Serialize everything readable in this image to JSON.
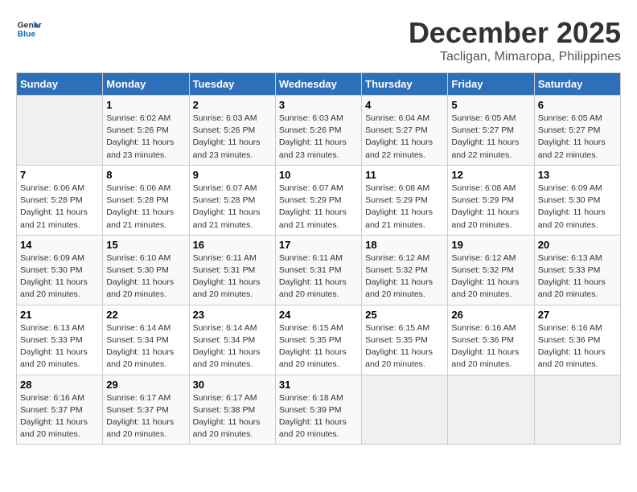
{
  "header": {
    "logo_line1": "General",
    "logo_line2": "Blue",
    "month_year": "December 2025",
    "location": "Tacligan, Mimaropa, Philippines"
  },
  "weekdays": [
    "Sunday",
    "Monday",
    "Tuesday",
    "Wednesday",
    "Thursday",
    "Friday",
    "Saturday"
  ],
  "weeks": [
    [
      {
        "day": "",
        "info": ""
      },
      {
        "day": "1",
        "info": "Sunrise: 6:02 AM\nSunset: 5:26 PM\nDaylight: 11 hours\nand 23 minutes."
      },
      {
        "day": "2",
        "info": "Sunrise: 6:03 AM\nSunset: 5:26 PM\nDaylight: 11 hours\nand 23 minutes."
      },
      {
        "day": "3",
        "info": "Sunrise: 6:03 AM\nSunset: 5:26 PM\nDaylight: 11 hours\nand 23 minutes."
      },
      {
        "day": "4",
        "info": "Sunrise: 6:04 AM\nSunset: 5:27 PM\nDaylight: 11 hours\nand 22 minutes."
      },
      {
        "day": "5",
        "info": "Sunrise: 6:05 AM\nSunset: 5:27 PM\nDaylight: 11 hours\nand 22 minutes."
      },
      {
        "day": "6",
        "info": "Sunrise: 6:05 AM\nSunset: 5:27 PM\nDaylight: 11 hours\nand 22 minutes."
      }
    ],
    [
      {
        "day": "7",
        "info": "Sunrise: 6:06 AM\nSunset: 5:28 PM\nDaylight: 11 hours\nand 21 minutes."
      },
      {
        "day": "8",
        "info": "Sunrise: 6:06 AM\nSunset: 5:28 PM\nDaylight: 11 hours\nand 21 minutes."
      },
      {
        "day": "9",
        "info": "Sunrise: 6:07 AM\nSunset: 5:28 PM\nDaylight: 11 hours\nand 21 minutes."
      },
      {
        "day": "10",
        "info": "Sunrise: 6:07 AM\nSunset: 5:29 PM\nDaylight: 11 hours\nand 21 minutes."
      },
      {
        "day": "11",
        "info": "Sunrise: 6:08 AM\nSunset: 5:29 PM\nDaylight: 11 hours\nand 21 minutes."
      },
      {
        "day": "12",
        "info": "Sunrise: 6:08 AM\nSunset: 5:29 PM\nDaylight: 11 hours\nand 20 minutes."
      },
      {
        "day": "13",
        "info": "Sunrise: 6:09 AM\nSunset: 5:30 PM\nDaylight: 11 hours\nand 20 minutes."
      }
    ],
    [
      {
        "day": "14",
        "info": "Sunrise: 6:09 AM\nSunset: 5:30 PM\nDaylight: 11 hours\nand 20 minutes."
      },
      {
        "day": "15",
        "info": "Sunrise: 6:10 AM\nSunset: 5:30 PM\nDaylight: 11 hours\nand 20 minutes."
      },
      {
        "day": "16",
        "info": "Sunrise: 6:11 AM\nSunset: 5:31 PM\nDaylight: 11 hours\nand 20 minutes."
      },
      {
        "day": "17",
        "info": "Sunrise: 6:11 AM\nSunset: 5:31 PM\nDaylight: 11 hours\nand 20 minutes."
      },
      {
        "day": "18",
        "info": "Sunrise: 6:12 AM\nSunset: 5:32 PM\nDaylight: 11 hours\nand 20 minutes."
      },
      {
        "day": "19",
        "info": "Sunrise: 6:12 AM\nSunset: 5:32 PM\nDaylight: 11 hours\nand 20 minutes."
      },
      {
        "day": "20",
        "info": "Sunrise: 6:13 AM\nSunset: 5:33 PM\nDaylight: 11 hours\nand 20 minutes."
      }
    ],
    [
      {
        "day": "21",
        "info": "Sunrise: 6:13 AM\nSunset: 5:33 PM\nDaylight: 11 hours\nand 20 minutes."
      },
      {
        "day": "22",
        "info": "Sunrise: 6:14 AM\nSunset: 5:34 PM\nDaylight: 11 hours\nand 20 minutes."
      },
      {
        "day": "23",
        "info": "Sunrise: 6:14 AM\nSunset: 5:34 PM\nDaylight: 11 hours\nand 20 minutes."
      },
      {
        "day": "24",
        "info": "Sunrise: 6:15 AM\nSunset: 5:35 PM\nDaylight: 11 hours\nand 20 minutes."
      },
      {
        "day": "25",
        "info": "Sunrise: 6:15 AM\nSunset: 5:35 PM\nDaylight: 11 hours\nand 20 minutes."
      },
      {
        "day": "26",
        "info": "Sunrise: 6:16 AM\nSunset: 5:36 PM\nDaylight: 11 hours\nand 20 minutes."
      },
      {
        "day": "27",
        "info": "Sunrise: 6:16 AM\nSunset: 5:36 PM\nDaylight: 11 hours\nand 20 minutes."
      }
    ],
    [
      {
        "day": "28",
        "info": "Sunrise: 6:16 AM\nSunset: 5:37 PM\nDaylight: 11 hours\nand 20 minutes."
      },
      {
        "day": "29",
        "info": "Sunrise: 6:17 AM\nSunset: 5:37 PM\nDaylight: 11 hours\nand 20 minutes."
      },
      {
        "day": "30",
        "info": "Sunrise: 6:17 AM\nSunset: 5:38 PM\nDaylight: 11 hours\nand 20 minutes."
      },
      {
        "day": "31",
        "info": "Sunrise: 6:18 AM\nSunset: 5:39 PM\nDaylight: 11 hours\nand 20 minutes."
      },
      {
        "day": "",
        "info": ""
      },
      {
        "day": "",
        "info": ""
      },
      {
        "day": "",
        "info": ""
      }
    ]
  ]
}
